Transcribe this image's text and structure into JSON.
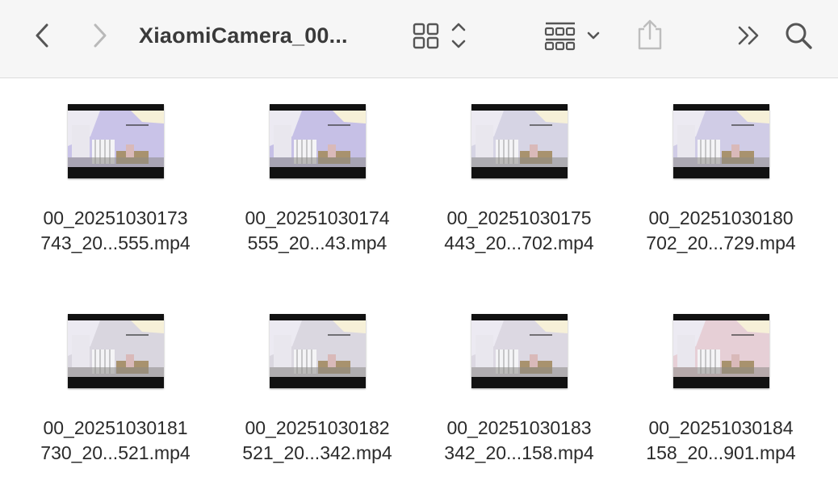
{
  "toolbar": {
    "title": "XiaomiCamera_00...",
    "back_icon": "chevron-left-icon",
    "forward_icon": "chevron-right-icon",
    "view_icon": "grid-view-icon",
    "group_icon": "group-by-icon",
    "share_icon": "share-icon",
    "more_icon": "double-chevron-icon",
    "search_icon": "search-icon"
  },
  "files": [
    {
      "line1": "00_20251030173",
      "line2": "743_20...555.mp4",
      "tint": "#c9c3e8"
    },
    {
      "line1": "00_20251030174",
      "line2": "555_20...43.mp4",
      "tint": "#c6c0e6"
    },
    {
      "line1": "00_20251030175",
      "line2": "443_20...702.mp4",
      "tint": "#d6d4e4"
    },
    {
      "line1": "00_20251030180",
      "line2": "702_20...729.mp4",
      "tint": "#d0cce6"
    },
    {
      "line1": "00_20251030181",
      "line2": "730_20...521.mp4",
      "tint": "#d9d6df"
    },
    {
      "line1": "00_20251030182",
      "line2": "521_20...342.mp4",
      "tint": "#dad7e0"
    },
    {
      "line1": "00_20251030183",
      "line2": "342_20...158.mp4",
      "tint": "#dcd8e2"
    },
    {
      "line1": "00_20251030184",
      "line2": "158_20...901.mp4",
      "tint": "#e6cfd6"
    }
  ]
}
